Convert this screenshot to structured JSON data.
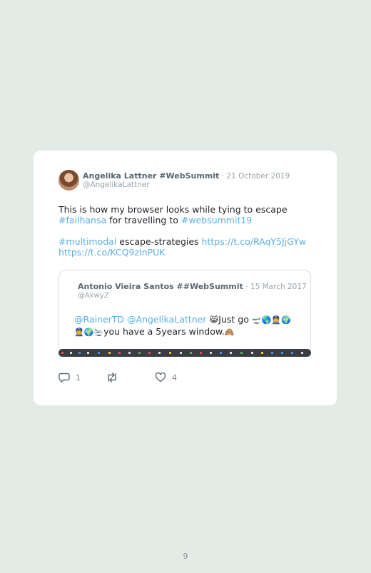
{
  "tweet": {
    "author_name": "Angelika Lattner #WebSummit",
    "date": "· 21 October 2019",
    "handle": "@AngelikaLattner",
    "text": {
      "l1": "This is how my browser looks while tying to escape",
      "l2_tag1": "#failhansa",
      "l2_mid": " for travelling to ",
      "l2_tag2": "#websummit19",
      "l3_tag": "#multimodal",
      "l3_mid": " escape-strategies ",
      "l3_link1": "https://t.co/RAqY5JjGYw",
      "l4_link2": "https://t.co/KCQ9zInPUK"
    },
    "quoted": {
      "author_name": "Antonio Vieira Santos ##WebSummit",
      "date": "· 15 March 2017",
      "handle": "@AkwyZ",
      "mention1": "@RainerTD",
      "mention2": "@AngelikaLattner",
      "emoji_cat": "😹",
      "text1": "Just go ",
      "emojis1": "🛫🌎👮🌍",
      "emojis2": "👮🌍🛬",
      "text2": "you have a 5years window.",
      "emoji_end": "🙈"
    },
    "actions": {
      "reply_count": "1",
      "retweet_count": "",
      "like_count": "4"
    }
  },
  "page_number": "9",
  "colors": {
    "background": "#e3ebe7",
    "card": "#ffffff",
    "link": "#5aaee6",
    "muted": "#9aa4ad"
  }
}
